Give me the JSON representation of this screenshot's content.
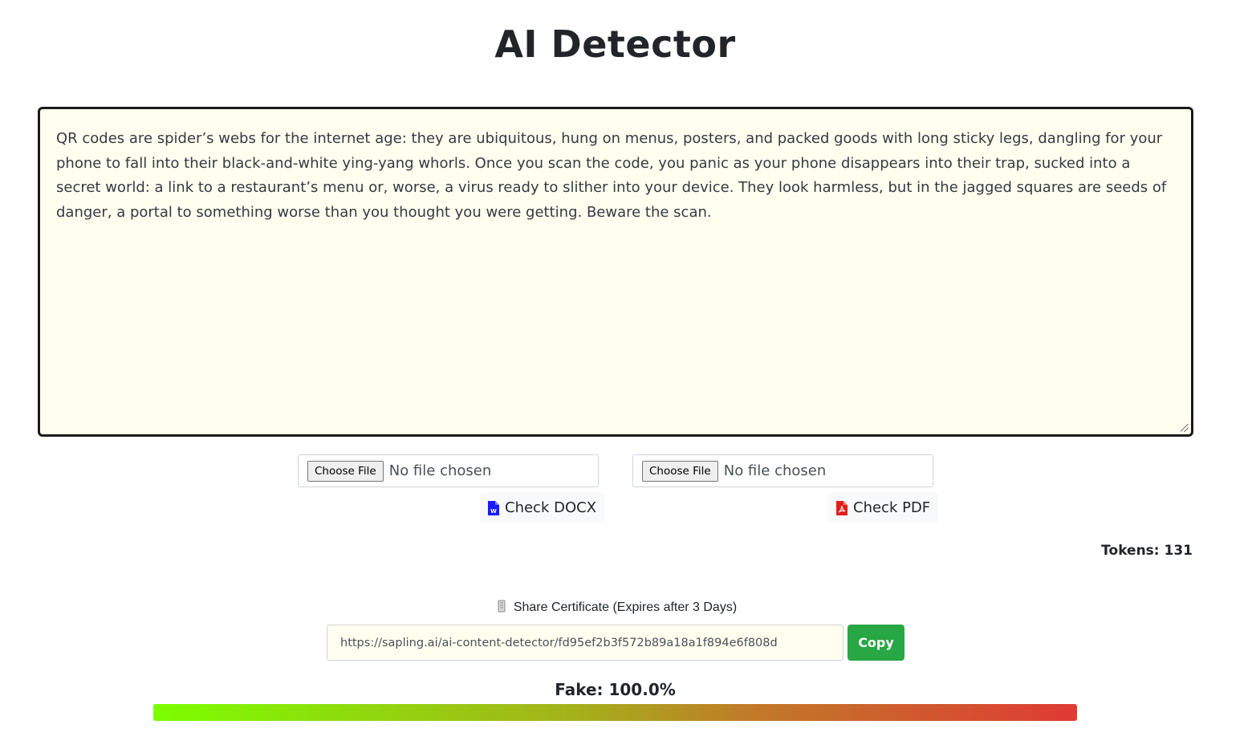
{
  "header": {
    "title": "AI Detector"
  },
  "editor": {
    "text": "QR codes are spider’s webs for the internet age: they are ubiquitous, hung on menus, posters, and packed goods with long sticky legs, dangling for your phone to fall into their black-and-white ying-yang whorls. Once you scan the code, you panic as your phone disappears into their trap, sucked into a secret world: a link to a restaurant’s menu or, worse, a virus ready to slither into your device. They look harmless, but in the jagged squares are seeds of danger, a portal to something worse than you thought you were getting. Beware the scan."
  },
  "upload": {
    "docx": {
      "choose_label": "Choose File",
      "status": "No file chosen",
      "check_label": "Check DOCX",
      "icon": "word-doc-icon",
      "icon_color": "#1a1aff"
    },
    "pdf": {
      "choose_label": "Choose File",
      "status": "No file chosen",
      "check_label": "Check PDF",
      "icon": "pdf-icon",
      "icon_color": "#e0201b"
    }
  },
  "tokens": {
    "label": "Tokens: 131"
  },
  "share": {
    "icon": "scroll-icon",
    "label": "Share Certificate (Expires after 3 Days)",
    "url": "https://sapling.ai/ai-content-detector/fd95ef2b3f572b89a18a1f894e6f808d",
    "copy_label": "Copy",
    "copy_color": "#28a745"
  },
  "result": {
    "label": "Fake: 100.0%",
    "fake_fraction": 1.0
  }
}
